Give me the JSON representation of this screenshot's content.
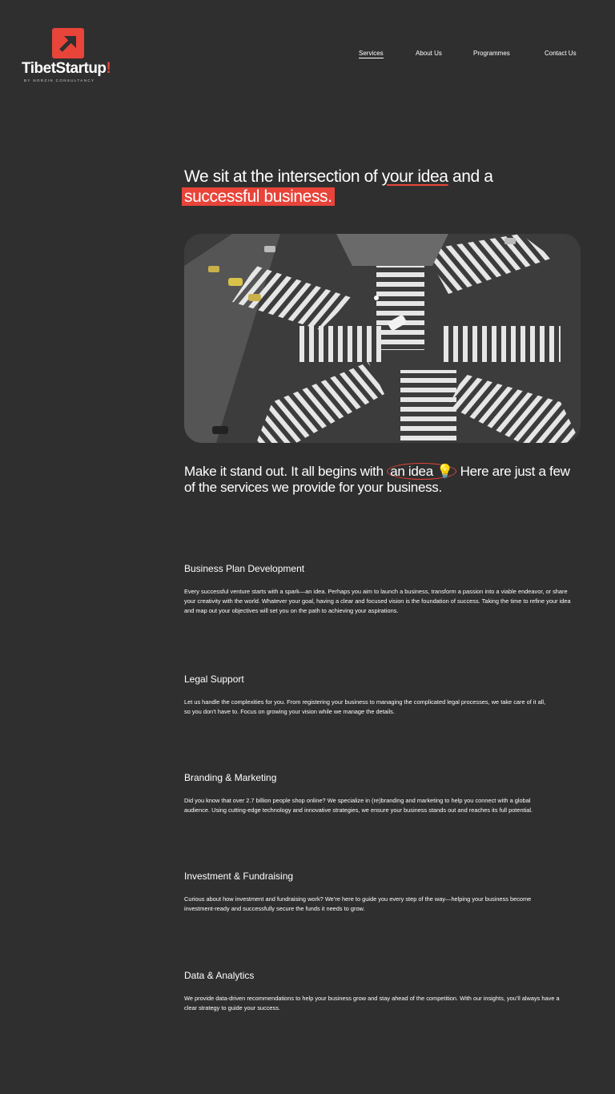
{
  "brand": {
    "name": "TibetStartup",
    "bang": "!",
    "tagline": "BY NORZIN CONSULTANCY",
    "accent": "#e8443a"
  },
  "nav": {
    "items": [
      "Services",
      "About Us",
      "Programmes",
      "Contact Us"
    ],
    "active": "Services"
  },
  "hero": {
    "title_part1": "We sit at the intersection of ",
    "title_underlined": "your idea",
    "title_part2": " and a ",
    "title_highlight": "successful business."
  },
  "intro": {
    "part1": "Make it stand out. It all begins with ",
    "circled": "an idea",
    "icon": "lightbulb-icon",
    "part2": " Here are just a few of the services we provide for your business."
  },
  "services": [
    {
      "title": "Business  Plan Development",
      "description": "Every successful venture starts with a spark—an idea. Perhaps you aim to launch a business, transform a passion into a viable endeavor, or share your creativity with the world. Whatever your goal, having a clear and focused vision is the foundation of success. Taking the time to refine your idea and map out your objectives will set you on the path to achieving your aspirations."
    },
    {
      "title": "Legal Support",
      "description": "Let us handle the complexities for you. From registering your business to managing the complicated legal processes, we take care of it all, so you don’t have to. Focus on growing your vision while we manage the details."
    },
    {
      "title": "Branding & Marketing",
      "description": "Did you know that over 2.7 billion people shop online? We specialize in (re)branding and marketing to help you connect with a global audience. Using cutting-edge technology and innovative strategies, we ensure your business stands out and reaches its full potential."
    },
    {
      "title": "Investment & Fundraising",
      "description": "Curious about how investment and fundraising work? We’re here to guide you every step of the way—helping your business become investment-ready and successfully secure the funds it needs to grow."
    },
    {
      "title": "Data & Analytics",
      "description": "We provide data-driven recommendations to help your business grow and stay ahead of the competition. With our insights, you’ll always have a clear strategy to guide your success."
    }
  ]
}
